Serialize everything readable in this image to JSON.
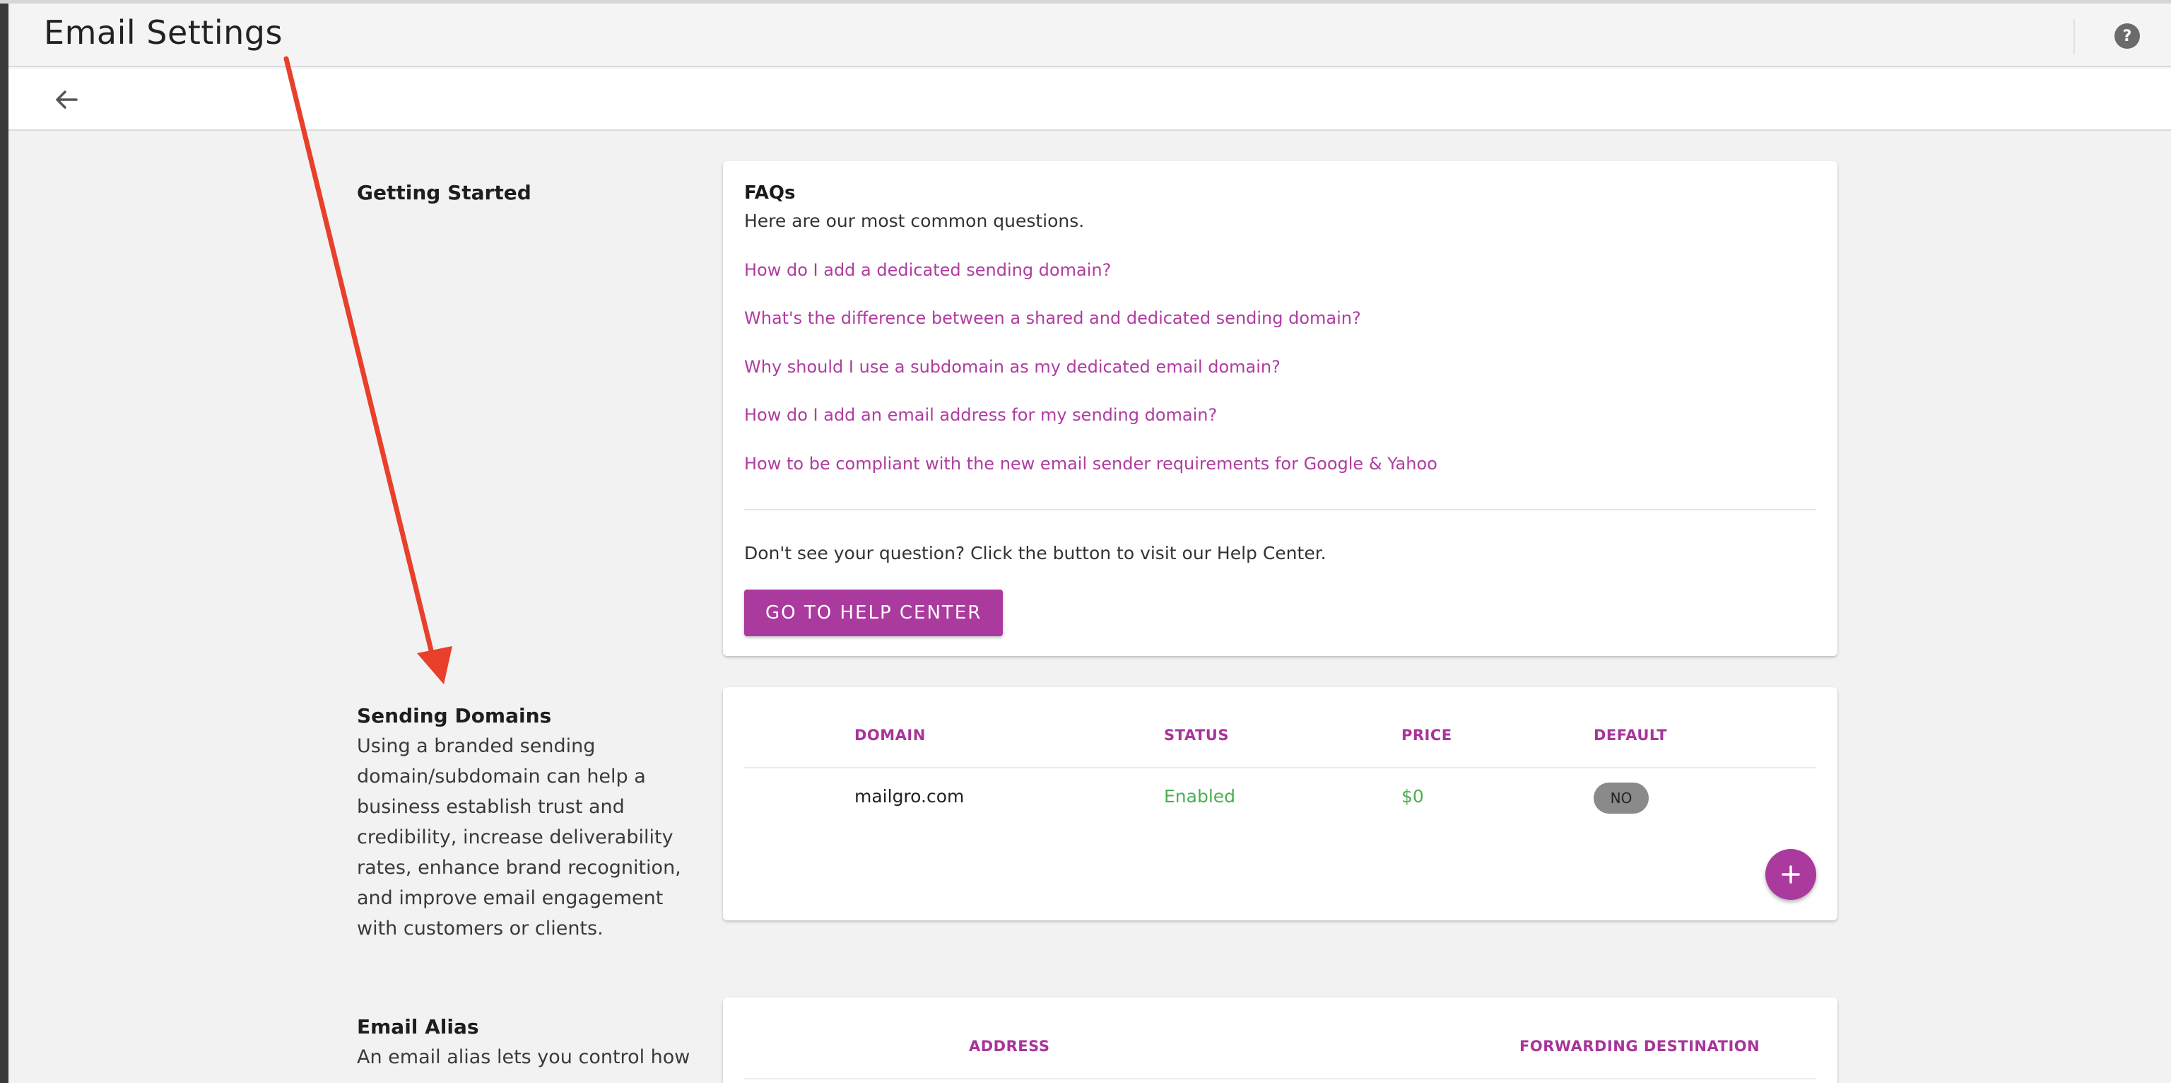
{
  "header": {
    "title": "Email Settings",
    "help_icon": "help-circle-icon",
    "help_symbol": "?"
  },
  "subbar": {
    "back_icon": "arrow-left-icon"
  },
  "getting_started": {
    "heading": "Getting Started",
    "faq": {
      "title": "FAQs",
      "subtitle": "Here are our most common questions.",
      "links": [
        "How do I add a dedicated sending domain?",
        "What's the difference between a shared and dedicated sending domain?",
        "Why should I use a subdomain as my dedicated email domain?",
        "How do I add an email address for my sending domain?",
        "How to be compliant with the new email sender requirements for Google & Yahoo"
      ],
      "footer_text": "Don't see your question? Click the button to visit our Help Center.",
      "help_center_button": "GO TO HELP CENTER"
    }
  },
  "sending_domains": {
    "heading": "Sending Domains",
    "description": "Using a branded sending domain/subdomain can help a business establish trust and credibility, increase deliverability rates, enhance brand recognition, and improve email engagement with customers or clients.",
    "columns": [
      "DOMAIN",
      "STATUS",
      "PRICE",
      "DEFAULT"
    ],
    "rows": [
      {
        "domain": "mailgro.com",
        "status": "Enabled",
        "price": "$0",
        "default": "NO"
      }
    ],
    "add_icon": "plus-icon"
  },
  "email_alias": {
    "heading": "Email Alias",
    "description": "An email alias lets you control how",
    "columns": [
      "ADDRESS",
      "FORWARDING DESTINATION"
    ]
  },
  "colors": {
    "accent": "#ab3a9e",
    "link": "#b03ca0",
    "enabled": "#4caf50",
    "annotation_arrow": "#e8402a"
  },
  "annotation": {
    "icon": "red-arrow-annotation"
  }
}
